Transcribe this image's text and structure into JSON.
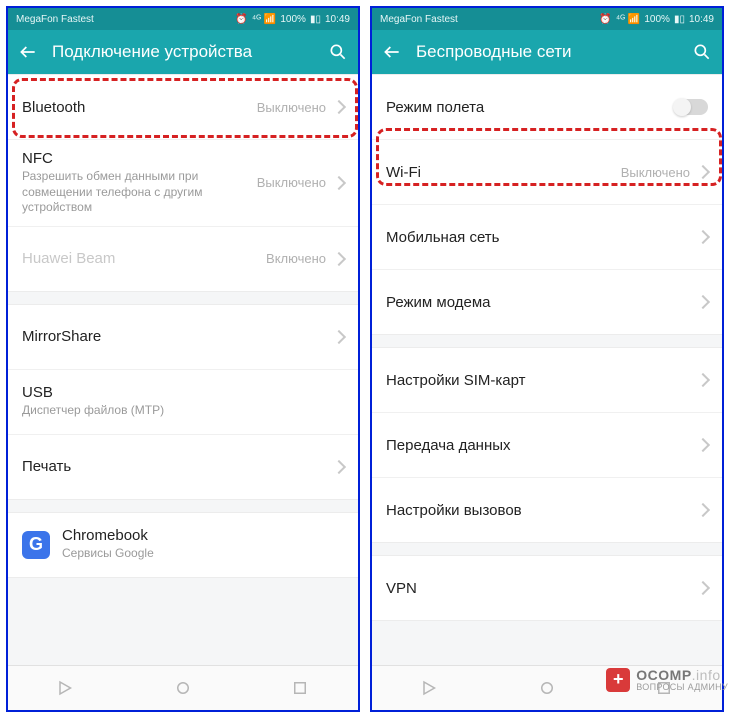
{
  "status": {
    "carrier": "MegaFon Fastest",
    "battery_pct": "100%",
    "time": "10:49"
  },
  "left": {
    "title": "Подключение устройства",
    "rows": {
      "bluetooth": {
        "label": "Bluetooth",
        "value": "Выключено"
      },
      "nfc": {
        "label": "NFC",
        "sub": "Разрешить обмен данными при совмещении телефона с другим устройством",
        "value": "Выключено"
      },
      "huawei_beam": {
        "label": "Huawei Beam",
        "value": "Включено"
      },
      "mirrorshare": {
        "label": "MirrorShare"
      },
      "usb": {
        "label": "USB",
        "sub": "Диспетчер файлов (MTP)"
      },
      "print": {
        "label": "Печать"
      },
      "chromebook": {
        "label": "Chromebook",
        "sub": "Сервисы Google"
      }
    }
  },
  "right": {
    "title": "Беспроводные сети",
    "rows": {
      "airplane": {
        "label": "Режим полета"
      },
      "wifi": {
        "label": "Wi-Fi",
        "value": "Выключено"
      },
      "mobile": {
        "label": "Мобильная сеть"
      },
      "tether": {
        "label": "Режим модема"
      },
      "sim": {
        "label": "Настройки SIM-карт"
      },
      "data": {
        "label": "Передача данных"
      },
      "calls": {
        "label": "Настройки вызовов"
      },
      "vpn": {
        "label": "VPN"
      }
    }
  },
  "watermark": {
    "brand1": "OCOMP",
    "brand2": ".info",
    "tagline": "ВОПРОСЫ АДМИНУ"
  }
}
